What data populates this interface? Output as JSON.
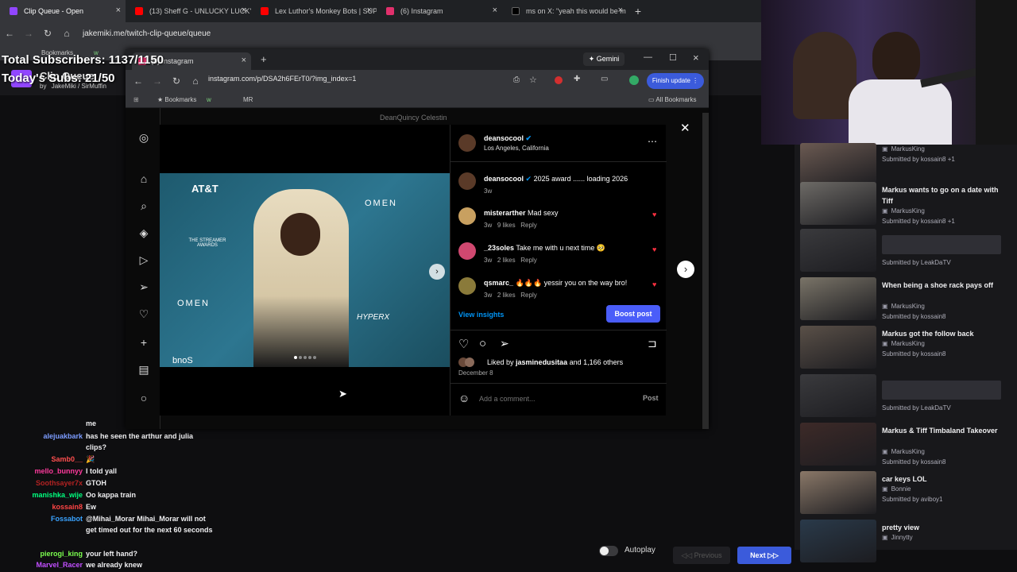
{
  "browser": {
    "tabs": [
      {
        "label": "Clip Queue - Open",
        "color": "#9146ff"
      },
      {
        "label": "(13) Sheff G - UNLUCKY LUCKY",
        "color": "#ff0000"
      },
      {
        "label": "Lex Luthor's Monkey Bots | SUP",
        "color": "#ff0000"
      },
      {
        "label": "(6) Instagram",
        "color": "#e1306c"
      },
      {
        "label": "ms on X: \"yeah this would be m",
        "color": "#000000"
      }
    ],
    "url": "jakemiki.me/twitch-clip-queue/queue",
    "bookmarks": [
      "Bookmarks",
      "w"
    ]
  },
  "overlay": {
    "total_subs": "Total Subscribers: 1137/1150",
    "today_subs": "Today's Subs: 21/50",
    "clip_queue": "Clip Queue",
    "by": "by",
    "author": "JakeMiki",
    "sep": "/",
    "author2": "SirMuffin"
  },
  "popup": {
    "tab_label": "(6) Instagram",
    "gemini": "Gemini",
    "url": "instagram.com/p/DSA2h6FErT0/?img_index=1",
    "finish_update": "Finish update",
    "bookmarks": [
      "Bookmarks",
      "w",
      "MR"
    ],
    "all_bookmarks": "All Bookmarks",
    "bg_name": "DeanQuincy Celestin",
    "photo_texts": [
      "AT&T",
      "OMEN",
      "THE STREAMER AWARDS",
      "HYPERX",
      "OMEN",
      "bnoS"
    ]
  },
  "post": {
    "username": "deansocool",
    "location": "Los Angeles, California",
    "caption_user": "deansocool",
    "caption": "2025 award ...... loading 2026",
    "caption_time": "3w",
    "comments": [
      {
        "user": "misterarther",
        "text": "Mad sexy",
        "time": "3w",
        "likes": "9 likes",
        "reply": "Reply"
      },
      {
        "user": "_23soles",
        "text": "Take me with u next time 🥺",
        "time": "3w",
        "likes": "2 likes",
        "reply": "Reply"
      },
      {
        "user": "qsmarc_",
        "text": "🔥🔥🔥 yessir you on the way bro!",
        "time": "3w",
        "likes": "2 likes",
        "reply": "Reply"
      }
    ],
    "view_insights": "View insights",
    "boost": "Boost post",
    "liked_by_prefix": "Liked by",
    "liked_by_user": "jasminedusitaa",
    "liked_by_suffix": "and 1,166 others",
    "date": "December 8",
    "comment_placeholder": "Add a comment...",
    "post_btn": "Post"
  },
  "queue": [
    {
      "title": "",
      "channel": "MarkusKing",
      "submitted": "Submitted by kossain8 +1",
      "thumb": "#6b5a52",
      "skeleton": false
    },
    {
      "title": "Markus wants to go on a date with Tiff",
      "channel": "MarkusKing",
      "submitted": "Submitted by kossain8 +1",
      "thumb": "#6d6a66",
      "skeleton": false
    },
    {
      "title": "",
      "channel": "",
      "submitted": "Submitted by LeakDaTV",
      "thumb": "#3a3a3d",
      "skeleton": true
    },
    {
      "title": "When being a shoe rack pays off",
      "channel": "MarkusKing",
      "submitted": "Submitted by kossain8",
      "thumb": "#7a7468",
      "skeleton": false
    },
    {
      "title": "Markus got the follow back",
      "channel": "MarkusKing",
      "submitted": "Submitted by kossain8",
      "thumb": "#5a5048",
      "skeleton": false
    },
    {
      "title": "",
      "channel": "",
      "submitted": "Submitted by LeakDaTV",
      "thumb": "#3a3a3d",
      "skeleton": true
    },
    {
      "title": "Markus & Tiff Timbaland Takeover",
      "channel": "MarkusKing",
      "submitted": "Submitted by kossain8",
      "thumb": "#3d2a28",
      "skeleton": false
    },
    {
      "title": "car keys LOL",
      "channel": "Bonnie",
      "submitted": "Submitted by aviboy1",
      "thumb": "#8a7868",
      "skeleton": false
    },
    {
      "title": "pretty view",
      "channel": "Jinnytty",
      "submitted": "",
      "thumb": "#2a3a4a",
      "skeleton": false
    }
  ],
  "chat": [
    {
      "name": "",
      "text": "me",
      "color": "#ffffff"
    },
    {
      "name": "alejuakbark",
      "text": "has he seen the arthur and julia clips?",
      "color": "#7c9cff"
    },
    {
      "name": "Samb0__",
      "text": "🎉",
      "color": "#ff4f4f"
    },
    {
      "name": "mello_bunnyy",
      "text": "I told yall",
      "color": "#ff3a9d"
    },
    {
      "name": "Soothsayer7x",
      "text": "GTOH",
      "color": "#b22222"
    },
    {
      "name": "manishka_wije",
      "text": "Oo kappa train",
      "color": "#00ff7f"
    },
    {
      "name": "kossain8",
      "text": "Ew",
      "color": "#ff4545"
    },
    {
      "name": "Fossabot",
      "text": "@Mihai_Morar Mihai_Morar will not get timed out for the next 60 seconds",
      "color": "#3aa3ff"
    },
    {
      "name": "pierogi_king",
      "text": "your left hand?",
      "color": "#7cff4f"
    },
    {
      "name": "Marvel_Racer",
      "text": "we already knew",
      "color": "#c24fff"
    }
  ],
  "controls": {
    "autoplay": "Autoplay",
    "previous": "Previous",
    "next": "Next"
  }
}
